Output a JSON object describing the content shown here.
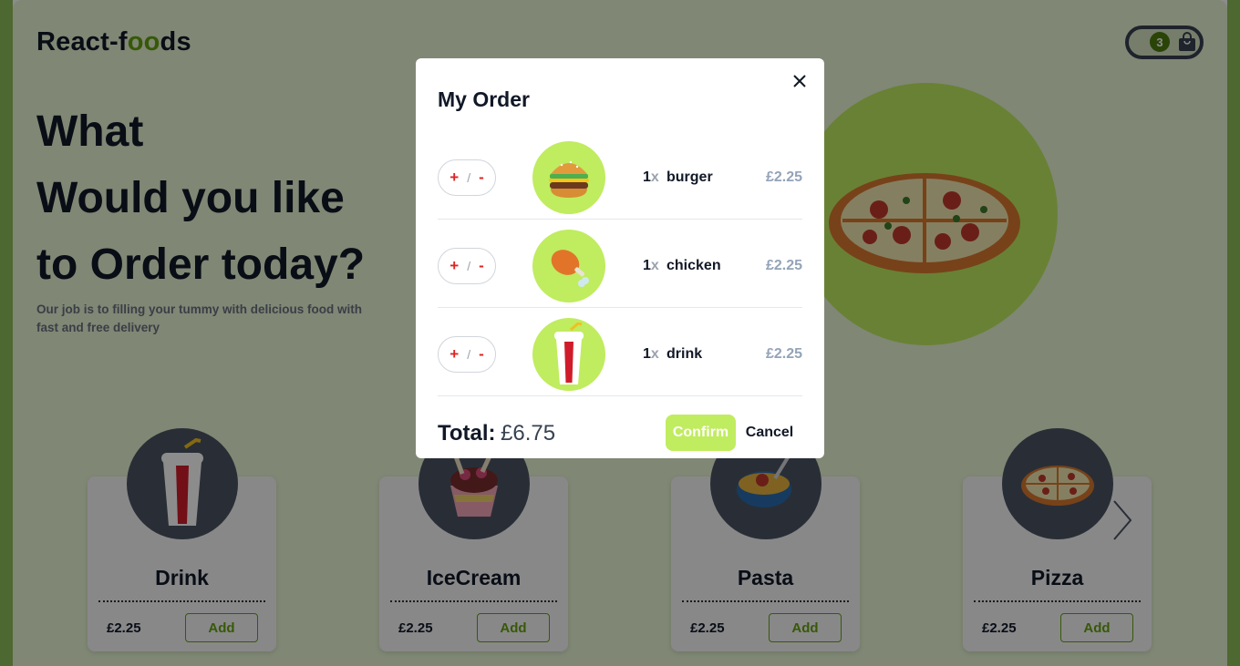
{
  "header": {
    "logo_prefix": "React-f",
    "logo_accent": "oo",
    "logo_suffix": "ds",
    "cart_count": "3"
  },
  "hero": {
    "title_line1": "What",
    "title_line2": "Would you like",
    "title_line3": "to Order today?",
    "subtitle": "Our job is to filling your tummy with delicious food with fast and free delivery"
  },
  "cards": [
    {
      "name": "Drink",
      "price": "£2.25",
      "add_label": "Add",
      "icon": "drink-icon"
    },
    {
      "name": "IceCream",
      "price": "£2.25",
      "add_label": "Add",
      "icon": "icecream-icon"
    },
    {
      "name": "Pasta",
      "price": "£2.25",
      "add_label": "Add",
      "icon": "pasta-icon"
    },
    {
      "name": "Pizza",
      "price": "£2.25",
      "add_label": "Add",
      "icon": "pizza-icon"
    }
  ],
  "modal": {
    "title": "My Order",
    "items": [
      {
        "qty": "1",
        "qty_x": "x",
        "name": "burger",
        "price": "£2.25",
        "plus": "+",
        "sep": "/",
        "minus": "-",
        "icon": "burger-icon"
      },
      {
        "qty": "1",
        "qty_x": "x",
        "name": "chicken",
        "price": "£2.25",
        "plus": "+",
        "sep": "/",
        "minus": "-",
        "icon": "chicken-icon"
      },
      {
        "qty": "1",
        "qty_x": "x",
        "name": "drink",
        "price": "£2.25",
        "plus": "+",
        "sep": "/",
        "minus": "-",
        "icon": "drink-icon"
      }
    ],
    "total_label": "Total:",
    "total_value": "£6.75",
    "confirm_label": "Confirm",
    "cancel_label": "Cancel"
  },
  "colors": {
    "accent": "#65a30d",
    "lime": "#c0ec5f",
    "page_bg": "#e9f6d5",
    "dark": "#111827",
    "remove_red": "#dc2626"
  }
}
